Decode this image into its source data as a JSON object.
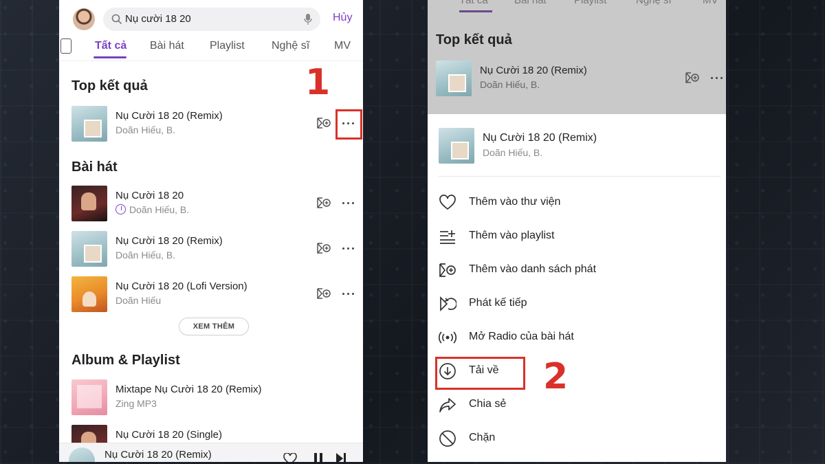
{
  "left_screen": {
    "search": {
      "query": "Nụ cười 18 20",
      "cancel_label": "Hủy"
    },
    "tabs": [
      "Tất cả",
      "Bài hát",
      "Playlist",
      "Nghệ sĩ",
      "MV"
    ],
    "top_result": {
      "heading": "Top kết quả",
      "item": {
        "title": "Nụ Cười 18 20 (Remix)",
        "artist": "Doãn Hiếu, B."
      }
    },
    "songs": {
      "heading": "Bài hát",
      "items": [
        {
          "title": "Nụ Cười 18 20",
          "artist": "Doãn Hiếu, B.",
          "downloaded": true
        },
        {
          "title": "Nụ Cười 18 20 (Remix)",
          "artist": "Doãn Hiếu, B.",
          "downloaded": false
        },
        {
          "title": "Nụ Cười 18 20 (Lofi Version)",
          "artist": "Doãn Hiếu",
          "downloaded": false
        }
      ],
      "more_label": "XEM THÊM"
    },
    "albums": {
      "heading": "Album & Playlist",
      "items": [
        {
          "title": "Mixtape Nụ Cười 18 20 (Remix)",
          "artist": "Zing MP3"
        },
        {
          "title": "Nụ Cười 18 20 (Single)"
        }
      ]
    },
    "mini_player": {
      "title": "Nụ Cười 18 20 (Remix)"
    },
    "step_label": "1"
  },
  "right_screen": {
    "dim_tabs": [
      "Tất cả",
      "Bài hát",
      "Playlist",
      "Nghệ sĩ",
      "MV"
    ],
    "top_result": {
      "heading": "Top kết quả",
      "item": {
        "title": "Nụ Cười 18 20 (Remix)",
        "artist": "Doãn Hiếu, B."
      }
    },
    "sheet": {
      "song": {
        "title": "Nụ Cười 18 20 (Remix)",
        "artist": "Doãn Hiếu, B."
      },
      "menu": [
        {
          "label": "Thêm vào thư viện",
          "icon": "heart-icon"
        },
        {
          "label": "Thêm vào playlist",
          "icon": "playlist-add-icon"
        },
        {
          "label": "Thêm vào danh sách phát",
          "icon": "queue-add-icon"
        },
        {
          "label": "Phát kế tiếp",
          "icon": "play-next-icon"
        },
        {
          "label": "Mở Radio của bài hát",
          "icon": "radio-icon"
        },
        {
          "label": "Tải về",
          "icon": "download-icon"
        },
        {
          "label": "Chia sẻ",
          "icon": "share-icon"
        },
        {
          "label": "Chặn",
          "icon": "block-icon"
        }
      ]
    },
    "step_label": "2"
  },
  "colors": {
    "accent": "#7b3fc2",
    "highlight": "#d9312a"
  }
}
